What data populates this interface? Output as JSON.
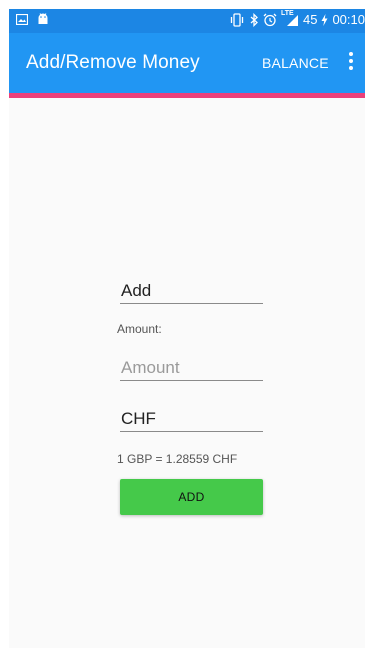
{
  "status_bar": {
    "battery": "45",
    "time": "00:10",
    "network": "LTE",
    "icons": [
      "image-icon",
      "android-icon",
      "vibrate-icon",
      "bluetooth-icon",
      "alarm-icon",
      "signal-icon",
      "charging-icon"
    ]
  },
  "appbar": {
    "title": "Add/Remove Money",
    "balance_label": "BALANCE",
    "overflow_icon": "more-vert-icon"
  },
  "form": {
    "action_value": "Add",
    "amount_label": "Amount:",
    "amount_placeholder": "Amount",
    "currency_value": "CHF",
    "rate_text": "1 GBP = 1.28559 CHF",
    "submit_label": "ADD"
  },
  "colors": {
    "status_bar": "#1c86e4",
    "appbar": "#2196f3",
    "accent_bar": "#ec407a",
    "add_button": "#45c94a"
  }
}
